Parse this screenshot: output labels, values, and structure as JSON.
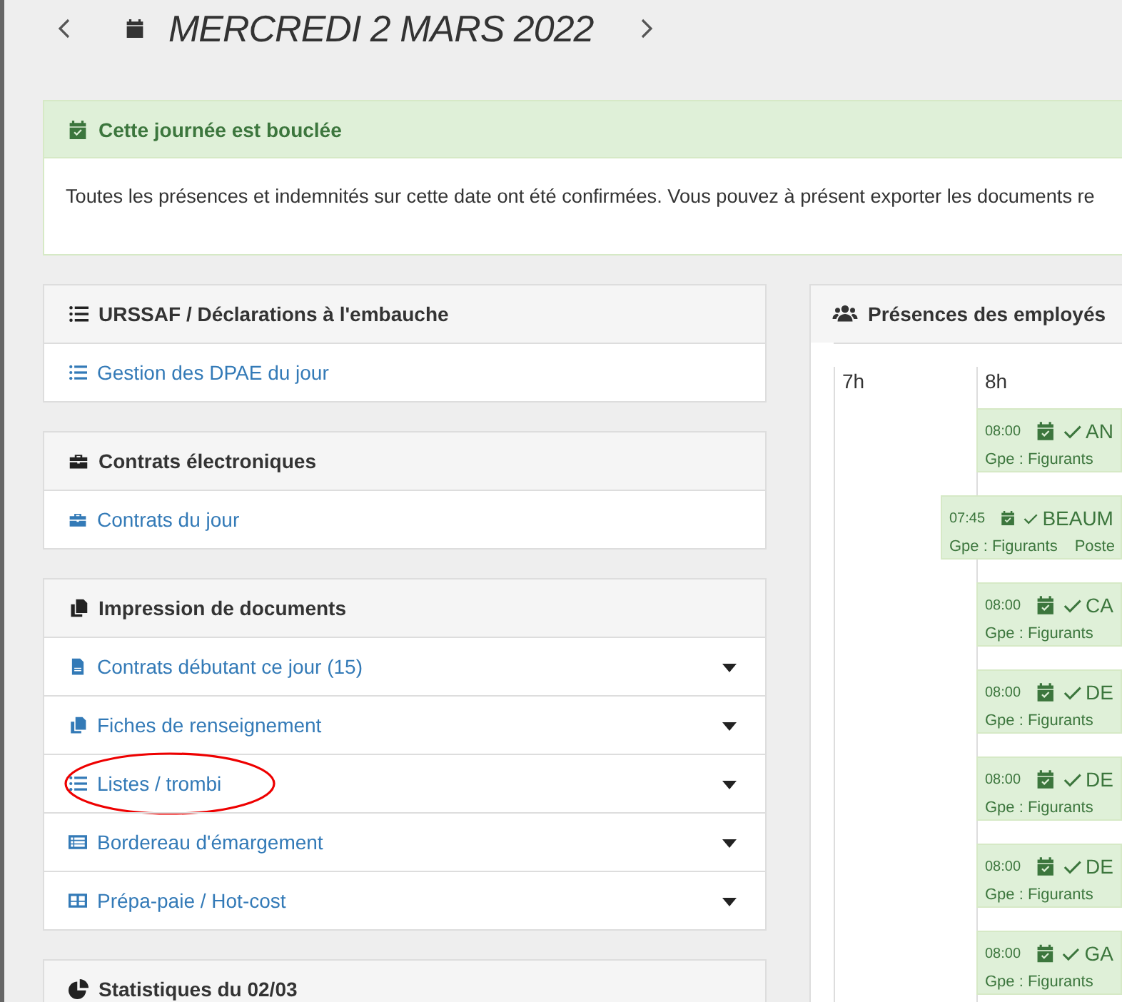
{
  "date_nav": {
    "title": "MERCREDI 2 MARS 2022"
  },
  "alert": {
    "title": "Cette journée est bouclée",
    "message": "Toutes les présences et indemnités sur cette date ont été confirmées. Vous pouvez à présent exporter les documents re"
  },
  "panels": [
    {
      "title": "URSSAF / Déclarations à l'embauche",
      "kind": "list",
      "items": [
        {
          "label": "Gestion des DPAE du jour",
          "kind": "list",
          "dropdown": false,
          "circled": false
        }
      ]
    },
    {
      "title": "Contrats électroniques",
      "kind": "briefcase",
      "items": [
        {
          "label": "Contrats du jour",
          "kind": "briefcase",
          "dropdown": false,
          "circled": false
        }
      ]
    },
    {
      "title": "Impression de documents",
      "kind": "copy",
      "items": [
        {
          "label": "Contrats débutant ce jour (15)",
          "kind": "file",
          "dropdown": true,
          "circled": false
        },
        {
          "label": "Fiches de renseignement",
          "kind": "copy",
          "dropdown": true,
          "circled": false
        },
        {
          "label": "Listes / trombi",
          "kind": "list",
          "dropdown": true,
          "circled": true
        },
        {
          "label": "Bordereau d'émargement",
          "kind": "rectlist",
          "dropdown": true,
          "circled": false
        },
        {
          "label": "Prépa-paie / Hot-cost",
          "kind": "grid",
          "dropdown": true,
          "circled": false
        }
      ]
    },
    {
      "title": "Statistiques du 02/03",
      "kind": "pie"
    }
  ],
  "presences": {
    "title": "Présences des employés",
    "hours": [
      "7h",
      "8h"
    ],
    "entries": [
      {
        "time": "08:00",
        "name": "AN",
        "group": "Gpe : Figurants",
        "confirmed": true
      },
      {
        "time": "07:45",
        "name": "BEAUM",
        "group": "Gpe : Figurants",
        "post": "Poste",
        "confirmed": true
      },
      {
        "time": "08:00",
        "name": "CA",
        "group": "Gpe : Figurants",
        "confirmed": true
      },
      {
        "time": "08:00",
        "name": "DE",
        "group": "Gpe : Figurants",
        "confirmed": true
      },
      {
        "time": "08:00",
        "name": "DE",
        "group": "Gpe : Figurants",
        "confirmed": true
      },
      {
        "time": "08:00",
        "name": "DE",
        "group": "Gpe : Figurants",
        "confirmed": true
      },
      {
        "time": "08:00",
        "name": "GA",
        "group": "Gpe : Figurants",
        "confirmed": true
      }
    ]
  }
}
